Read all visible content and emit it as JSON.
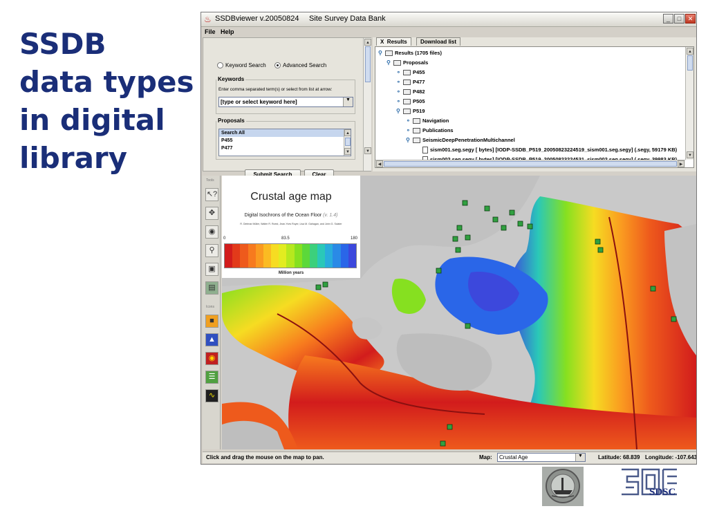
{
  "slide": {
    "title_lines": [
      "SSDB",
      "data types",
      "in digital",
      "library"
    ]
  },
  "window": {
    "app_name": "SSDBviewer v.20050824",
    "subtitle": "Site Survey Data Bank",
    "menu": [
      "File",
      "Help"
    ]
  },
  "search": {
    "mode_keyword": "Keyword Search",
    "mode_advanced": "Advanced Search",
    "selected_mode": "Advanced Search",
    "keywords_label": "Keywords",
    "keywords_hint": "Enter comma separated term(s) or select from list at arrow:",
    "keyword_value": "[type or select keyword here]",
    "proposals_label": "Proposals",
    "proposals": [
      "Search All",
      "P455",
      "P477"
    ],
    "submit_label": "Submit Search",
    "clear_label": "Clear"
  },
  "tabs": {
    "close_glyph": "X",
    "results": "Results",
    "download": "Download list"
  },
  "tree": {
    "root": "Results (1705 files)",
    "proposals": "Proposals",
    "p455": "P455",
    "p477": "P477",
    "p482": "P482",
    "p505": "P505",
    "p519": "P519",
    "navigation": "Navigation",
    "publications": "Publications",
    "seismic": "SeismicDeepPenetrationMultichannel",
    "file1": "sism001.seg.segy [ bytes] [IODP-SSDB_P519_20050823224519_sism001.seg.segy] (.segy, 59179 KB)",
    "file2": "sism002.seg.segy [ bytes] [IODP-SSDB_P519_20050823224531_sism002.seg.segy] (.segy, 39983 KB)"
  },
  "tools": {
    "tools_label": "Tools",
    "icons_label": "Icons"
  },
  "legend": {
    "title": "Crustal age map",
    "subtitle": "Digital Isochrons of the Ocean Floor",
    "version": "(v. 1.4)",
    "authors": "R. Dietmar Müller, Walter R. Roest, Jean-Yves Royer, Lisa M. Gahagan, and John G. Sclater",
    "tick_min": "0",
    "tick_mid": "83.5",
    "tick_max": "180",
    "unit": "Million years",
    "colors": [
      "#d21c1c",
      "#e23a1a",
      "#ee5a1c",
      "#f77a1e",
      "#fa9a20",
      "#fbbb22",
      "#f6dc22",
      "#e2ec20",
      "#b6e81e",
      "#86e020",
      "#5cd83a",
      "#3cd07c",
      "#2ac8b8",
      "#28acdc",
      "#2a8ae6",
      "#2a66e8",
      "#3c48dc"
    ]
  },
  "status": {
    "message": "Click and drag the mouse on the map to pan.",
    "map_label": "Map:",
    "map_value": "Crustal Age",
    "latitude": "Latitude: 68.839",
    "longitude": "Longitude: -107.643"
  },
  "logos": {
    "sdsc": "SDSC"
  }
}
